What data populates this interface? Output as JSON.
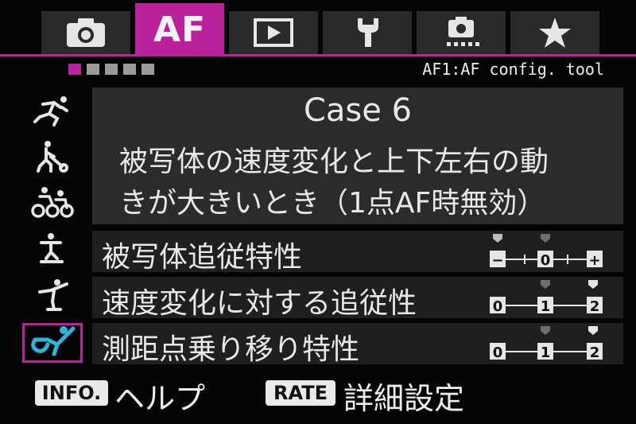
{
  "tabs": [
    {
      "name": "camera",
      "icon": "camera-icon",
      "label": ""
    },
    {
      "name": "af",
      "icon": "",
      "label": "AF"
    },
    {
      "name": "playback",
      "icon": "playback-icon",
      "label": ""
    },
    {
      "name": "setup",
      "icon": "wrench-icon",
      "label": ""
    },
    {
      "name": "custom",
      "icon": "custom-function-camera-icon",
      "label": ""
    },
    {
      "name": "mymenu",
      "icon": "star-icon",
      "label": ""
    }
  ],
  "page_indicator": {
    "total": 5,
    "current": 1
  },
  "menu_title": "AF1:AF config. tool",
  "cases": [
    {
      "name": "case-1",
      "icon": "sprinter-icon",
      "selected": false
    },
    {
      "name": "case-2",
      "icon": "golfer-icon",
      "selected": false
    },
    {
      "name": "case-3",
      "icon": "cyclists-icon",
      "selected": false
    },
    {
      "name": "case-4",
      "icon": "skier-icon",
      "selected": false
    },
    {
      "name": "case-5",
      "icon": "figure-skater-icon",
      "selected": false
    },
    {
      "name": "case-6",
      "icon": "gymnast-icon",
      "selected": true
    }
  ],
  "description": {
    "title": "Case 6",
    "line1": "被写体の速度変化と上下左右の動",
    "line2": "きが大きいとき（1点AF時無効）"
  },
  "params": [
    {
      "label": "被写体追従特性",
      "scale": [
        "−",
        "0",
        "+"
      ],
      "default_index": 0,
      "value_index": 1
    },
    {
      "label": "速度変化に対する追従性",
      "scale": [
        "0",
        "1",
        "2"
      ],
      "default_index": 1,
      "value_index": 2
    },
    {
      "label": "測距点乗り移り特性",
      "scale": [
        "0",
        "1",
        "2"
      ],
      "default_index": 1,
      "value_index": 2
    }
  ],
  "footer": {
    "info_key": "INFO.",
    "info_label": "ヘルプ",
    "rate_key": "RATE",
    "rate_label": "詳細設定"
  },
  "colors": {
    "accent": "#b9229b",
    "selected_icon": "#2fb4d8",
    "panel": "#2b2b2b"
  }
}
